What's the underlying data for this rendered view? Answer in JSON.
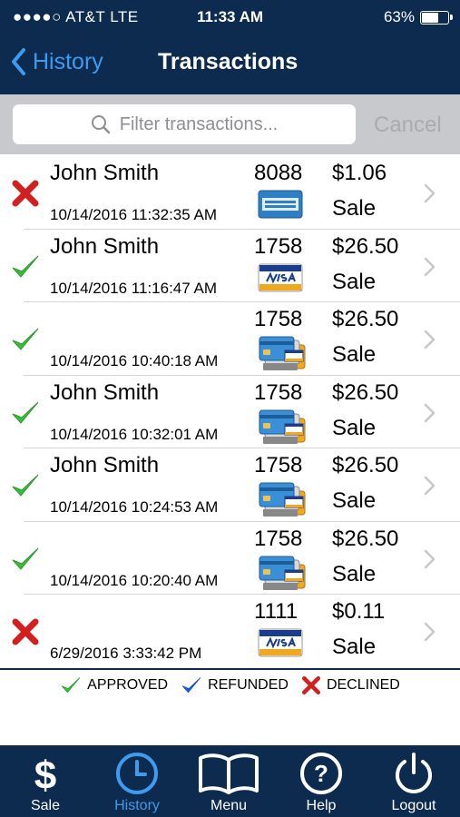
{
  "status_bar": {
    "carrier": "●●●●○ AT&T  LTE",
    "time": "11:33 AM",
    "battery": "63%",
    "battery_level": 0.63
  },
  "nav": {
    "back_label": "History",
    "title": "Transactions"
  },
  "search": {
    "placeholder": "Filter transactions...",
    "cancel_label": "Cancel"
  },
  "transactions": [
    {
      "status": "declined",
      "name": "John Smith",
      "datetime": "10/14/2016 11:32:35 AM",
      "last4": "8088",
      "amount": "$1.06",
      "type": "Sale",
      "card": "amex"
    },
    {
      "status": "approved",
      "name": "John Smith",
      "datetime": "10/14/2016 11:16:47 AM",
      "last4": "1758",
      "amount": "$26.50",
      "type": "Sale",
      "card": "visa"
    },
    {
      "status": "approved",
      "name": "",
      "datetime": "10/14/2016 10:40:18 AM",
      "last4": "1758",
      "amount": "$26.50",
      "type": "Sale",
      "card": "multi"
    },
    {
      "status": "approved",
      "name": "John Smith",
      "datetime": "10/14/2016 10:32:01 AM",
      "last4": "1758",
      "amount": "$26.50",
      "type": "Sale",
      "card": "multi"
    },
    {
      "status": "approved",
      "name": "John Smith",
      "datetime": "10/14/2016 10:24:53 AM",
      "last4": "1758",
      "amount": "$26.50",
      "type": "Sale",
      "card": "multi"
    },
    {
      "status": "approved",
      "name": "",
      "datetime": "10/14/2016 10:20:40 AM",
      "last4": "1758",
      "amount": "$26.50",
      "type": "Sale",
      "card": "multi"
    },
    {
      "status": "declined",
      "name": "",
      "datetime": "6/29/2016 3:33:42 PM",
      "last4": "1111",
      "amount": "$0.11",
      "type": "Sale",
      "card": "visa"
    }
  ],
  "legend": {
    "approved": "APPROVED",
    "refunded": "REFUNDED",
    "declined": "DECLINED"
  },
  "tabs": [
    {
      "label": "Sale",
      "icon": "dollar-icon",
      "active": false
    },
    {
      "label": "History",
      "icon": "clock-icon",
      "active": true
    },
    {
      "label": "Menu",
      "icon": "book-icon",
      "active": false
    },
    {
      "label": "Help",
      "icon": "help-icon",
      "active": false
    },
    {
      "label": "Logout",
      "icon": "power-icon",
      "active": false
    }
  ],
  "colors": {
    "nav_bg": "#0d2b4e",
    "accent": "#3d9cf0",
    "approved": "#3bbd3b",
    "declined": "#d21f1f",
    "refunded": "#1a5fd6"
  }
}
